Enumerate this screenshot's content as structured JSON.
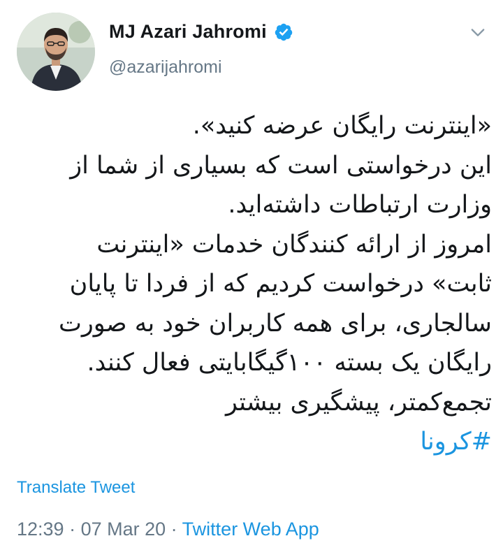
{
  "author": {
    "display_name": "MJ Azari Jahromi",
    "handle": "@azarijahromi",
    "verified": true
  },
  "tweet": {
    "lines": [
      "«اینترنت رایگان عرضه کنید».",
      "این درخواستی است که بسیاری از شما از",
      "وزارت ارتباطات داشته‌اید.",
      "امروز از ارائه کنندگان خدمات «اینترنت",
      "ثابت» درخواست کردیم که از فردا تا پایان",
      "سالجاری، برای همه کاربران خود به صورت",
      "رایگان یک بسته ۱۰۰گیگابایتی فعال کنند.",
      "تجمع‌کمتر، پیشگیری بیشتر"
    ],
    "hashtag": "#کرونا"
  },
  "actions": {
    "translate_label": "Translate Tweet"
  },
  "meta": {
    "time": "12:39",
    "separator": " · ",
    "date": "07 Mar 20",
    "source": "Twitter Web App"
  },
  "colors": {
    "link": "#1b95e0",
    "secondary_text": "#657786",
    "verified_badge": "#1da1f2"
  },
  "icons": {
    "verified": "verified-badge-icon",
    "menu": "chevron-down-icon"
  }
}
